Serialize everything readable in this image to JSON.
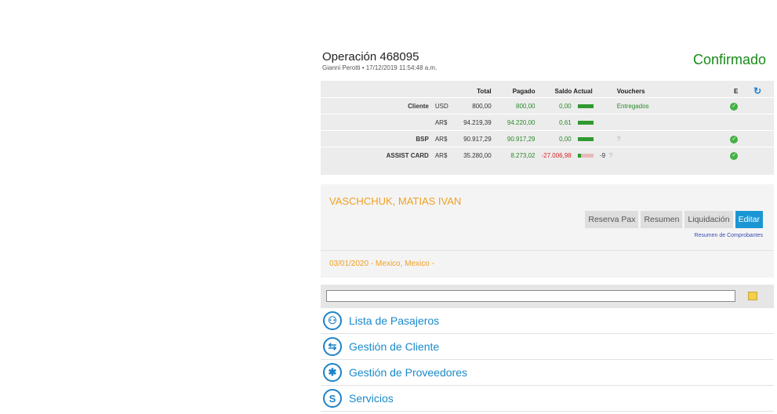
{
  "operation": {
    "title": "Operación 468095",
    "subtitle": "Gianni Perotti • 17/12/2019 11:54:48 a.m.",
    "status": "Confirmado"
  },
  "financial": {
    "headers": {
      "total": "Total",
      "pagado": "Pagado",
      "saldo": "Saldo Actual",
      "vouchers": "Vouchers",
      "e": "E"
    },
    "rows": [
      {
        "label": "Cliente",
        "currency": "USD",
        "total": "800,00",
        "pagado": "800,00",
        "saldo": "0,00",
        "vouchers": "Entregados",
        "ok": true
      },
      {
        "label": "",
        "currency": "AR$",
        "total": "94.219,39",
        "pagado": "94.220,00",
        "saldo": "0,61",
        "vouchers": "",
        "ok": false
      },
      {
        "label": "BSP",
        "currency": "AR$",
        "total": "90.917,29",
        "pagado": "90.917,29",
        "saldo": "0,00",
        "vouchers": "?",
        "ok": true
      },
      {
        "label": "ASSIST CARD",
        "currency": "AR$",
        "total": "35.280,00",
        "pagado": "8.273,02",
        "saldo": "-27.006,98",
        "extra": "-9",
        "vouchers": "?",
        "ok": true
      }
    ]
  },
  "passenger": {
    "name": "VASCHCHUK, MATIAS IVAN",
    "buttons": {
      "reserva": "Reserva Pax",
      "resumen": "Resumen",
      "liquidacion": "Liquidación",
      "editar": "Editar"
    },
    "comprobantes_link": "Resumen de Comprobantes",
    "trip": "03/01/2020 - Mexico, Mexico -"
  },
  "menu": [
    {
      "label": "Lista de Pasajeros",
      "icon": "passengers-icon"
    },
    {
      "label": "Gestión de Cliente",
      "icon": "client-icon"
    },
    {
      "label": "Gestión de Proveedores",
      "icon": "providers-icon"
    },
    {
      "label": "Servicios",
      "icon": "services-icon"
    }
  ],
  "colors": {
    "status": "#1a8a1a",
    "accent": "#1a96d4",
    "orange": "#f0a020"
  }
}
